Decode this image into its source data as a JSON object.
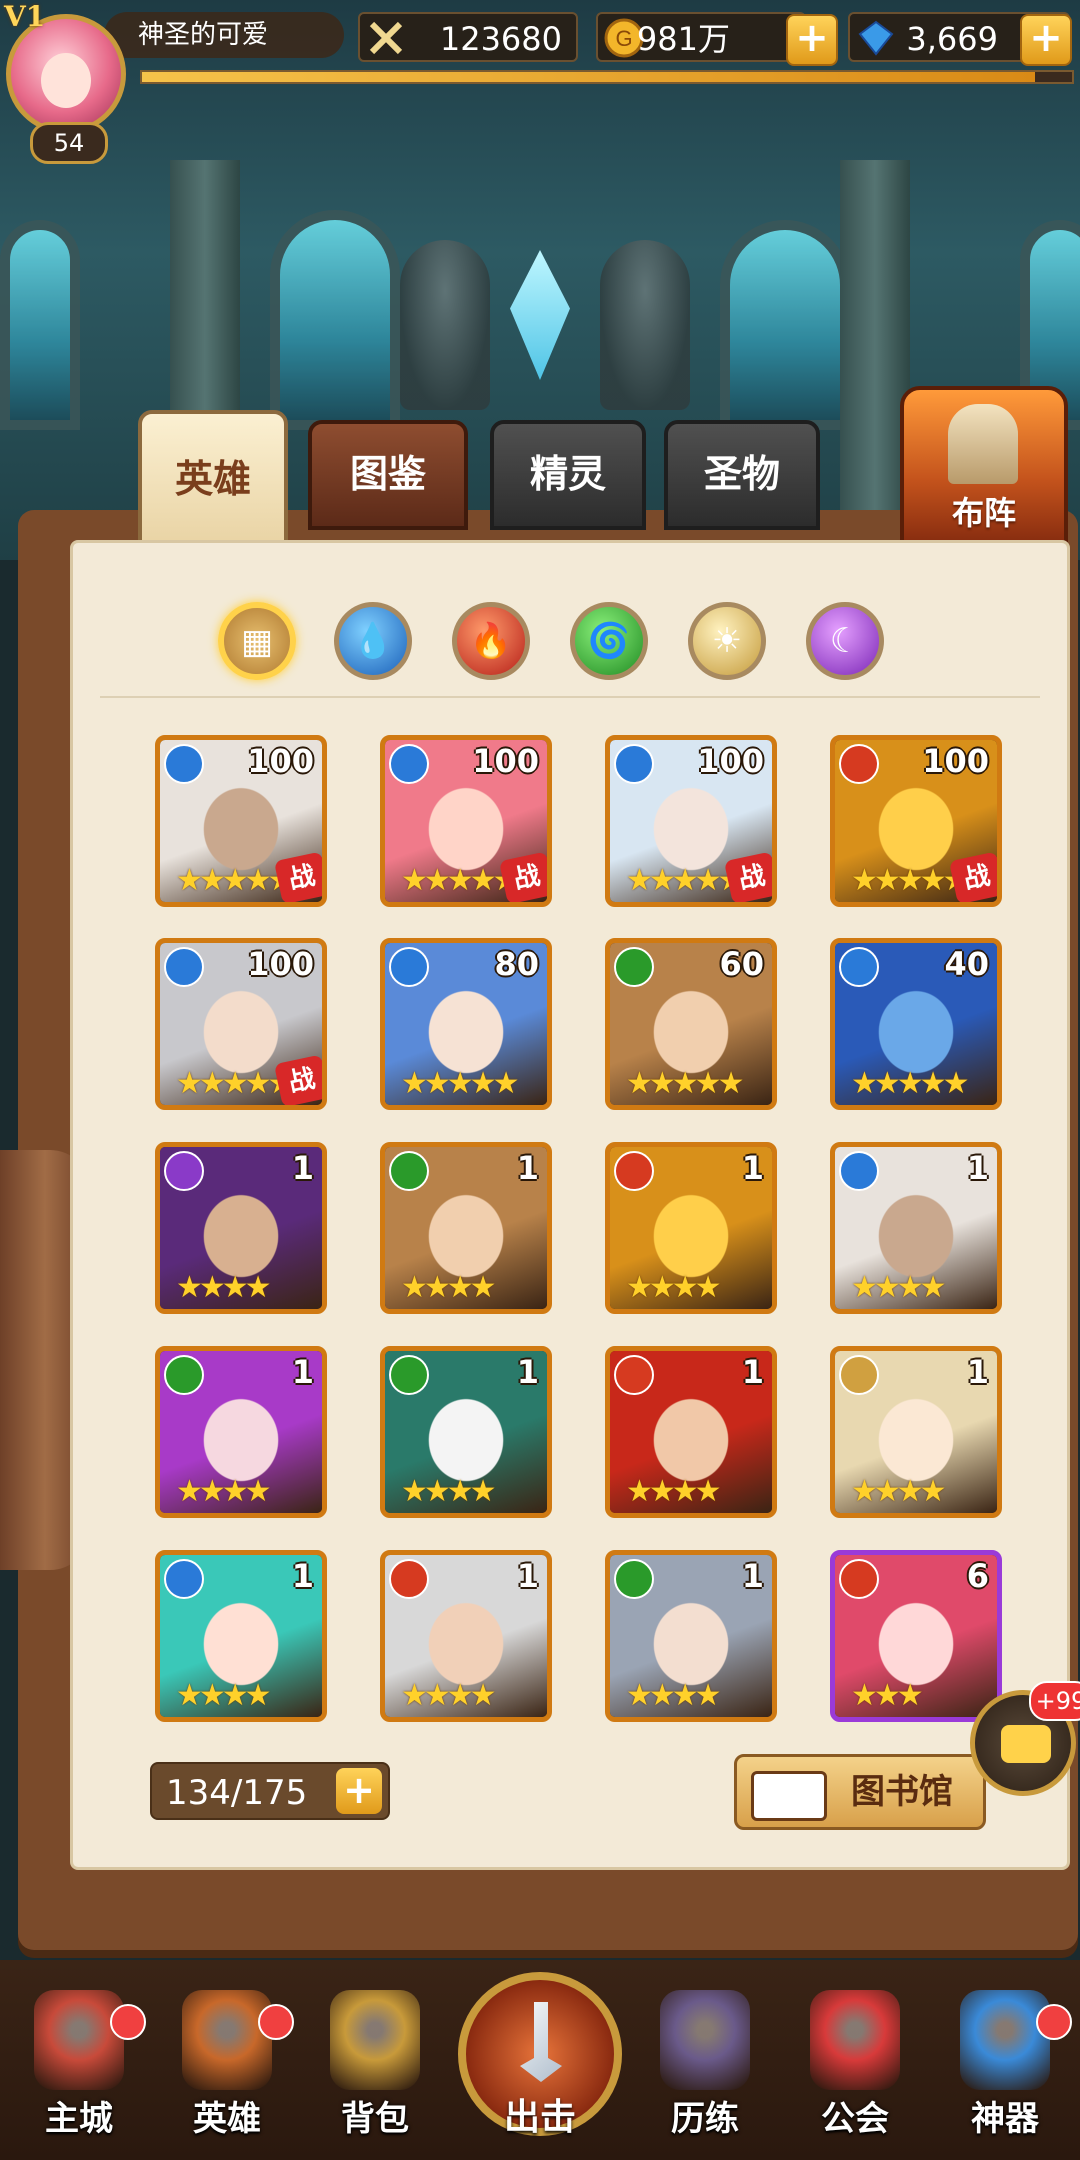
{
  "topbar": {
    "vip": "V1",
    "level": "54",
    "player_name": "神圣的可爱",
    "power": "123680",
    "gold": "981万",
    "gems": "3,669",
    "plus": "+"
  },
  "tabs": {
    "heroes": "英雄",
    "codex": "图鉴",
    "sprites": "精灵",
    "relics": "圣物",
    "formation": "布阵"
  },
  "filters": [
    {
      "name": "all",
      "icon": "grid-icon",
      "glyph": "▦"
    },
    {
      "name": "water",
      "icon": "water-drop-icon",
      "glyph": "💧"
    },
    {
      "name": "fire",
      "icon": "flame-icon",
      "glyph": "🔥"
    },
    {
      "name": "wind",
      "icon": "tornado-icon",
      "glyph": "🌀"
    },
    {
      "name": "light",
      "icon": "sun-icon",
      "glyph": "☀"
    },
    {
      "name": "dark",
      "icon": "moon-icon",
      "glyph": "☾"
    }
  ],
  "colors": {
    "water": "#2a7ad8",
    "fire": "#d63a20",
    "wind": "#2a9a2a",
    "light": "#d0a040",
    "dark": "#8a3ac8"
  },
  "heroes": [
    {
      "level": "100",
      "element": "water",
      "stars": "★★★★★",
      "battle": "战",
      "frame": "orange",
      "skin": "#c9a88e",
      "hair": "#e8e2dc"
    },
    {
      "level": "100",
      "element": "water",
      "stars": "★★★★★",
      "battle": "战",
      "frame": "orange",
      "skin": "#ffd4c8",
      "hair": "#f07a8a"
    },
    {
      "level": "100",
      "element": "water",
      "stars": "★★★★★",
      "battle": "战",
      "frame": "orange",
      "skin": "#f3e4dc",
      "hair": "#d8e6f2"
    },
    {
      "level": "100",
      "element": "fire",
      "stars": "★★★★★",
      "battle": "战",
      "frame": "orange",
      "skin": "#ffcf4a",
      "hair": "#d8901a"
    },
    {
      "level": "100",
      "element": "water",
      "stars": "★★★★★",
      "battle": "战",
      "frame": "orange",
      "skin": "#f3dccb",
      "hair": "#c8c8cc"
    },
    {
      "level": "80",
      "element": "water",
      "stars": "★★★★★",
      "battle": "",
      "frame": "orange",
      "skin": "#f6e2d4",
      "hair": "#5a8ad8"
    },
    {
      "level": "60",
      "element": "wind",
      "stars": "★★★★★",
      "battle": "",
      "frame": "orange",
      "skin": "#f1cfae",
      "hair": "#b8824a"
    },
    {
      "level": "40",
      "element": "water",
      "stars": "★★★★★",
      "battle": "",
      "frame": "orange",
      "skin": "#6aa8e8",
      "hair": "#2a5ab8"
    },
    {
      "level": "1",
      "element": "dark",
      "stars": "★★★★",
      "battle": "",
      "frame": "orange",
      "skin": "#d8b090",
      "hair": "#5a2a7a"
    },
    {
      "level": "1",
      "element": "wind",
      "stars": "★★★★",
      "battle": "",
      "frame": "orange",
      "skin": "#f1cfae",
      "hair": "#b8824a"
    },
    {
      "level": "1",
      "element": "fire",
      "stars": "★★★★",
      "battle": "",
      "frame": "orange",
      "skin": "#ffcf4a",
      "hair": "#d8901a"
    },
    {
      "level": "1",
      "element": "water",
      "stars": "★★★★",
      "battle": "",
      "frame": "orange",
      "skin": "#c9a88e",
      "hair": "#e8e2dc"
    },
    {
      "level": "1",
      "element": "wind",
      "stars": "★★★★",
      "battle": "",
      "frame": "orange",
      "skin": "#f6d8e0",
      "hair": "#a83ac8"
    },
    {
      "level": "1",
      "element": "wind",
      "stars": "★★★★",
      "battle": "",
      "frame": "orange",
      "skin": "#f4f4f4",
      "hair": "#2a7a6a"
    },
    {
      "level": "1",
      "element": "fire",
      "stars": "★★★★",
      "battle": "",
      "frame": "orange",
      "skin": "#f1c8a8",
      "hair": "#c8281a"
    },
    {
      "level": "1",
      "element": "light",
      "stars": "★★★★",
      "battle": "",
      "frame": "orange",
      "skin": "#fbe8d4",
      "hair": "#e8d8b0"
    },
    {
      "level": "1",
      "element": "water",
      "stars": "★★★★",
      "battle": "",
      "frame": "orange",
      "skin": "#ffe0d4",
      "hair": "#3ac8b8"
    },
    {
      "level": "1",
      "element": "fire",
      "stars": "★★★★",
      "battle": "",
      "frame": "orange",
      "skin": "#f1d0b8",
      "hair": "#d8d8d8"
    },
    {
      "level": "1",
      "element": "wind",
      "stars": "★★★★",
      "battle": "",
      "frame": "orange",
      "skin": "#f3ded0",
      "hair": "#9aa4b4"
    },
    {
      "level": "6",
      "element": "fire",
      "stars": "★★★",
      "battle": "",
      "frame": "purple",
      "skin": "#ffd8d8",
      "hair": "#e04a6a"
    }
  ],
  "roster": {
    "count": "134/175",
    "plus": "+"
  },
  "library": {
    "label": "图书馆"
  },
  "chat": {
    "badge": "+99"
  },
  "nav": [
    {
      "label": "主城",
      "icon": "castle-icon",
      "color": "#c84a3a",
      "dot": true
    },
    {
      "label": "英雄",
      "icon": "hero-icon",
      "color": "#c8682a",
      "dot": true
    },
    {
      "label": "背包",
      "icon": "bag-icon",
      "color": "#c89a3a",
      "dot": false
    },
    {
      "label": "出击",
      "icon": "crossed-swords-icon",
      "color": "#d8a43a",
      "dot": false
    },
    {
      "label": "历练",
      "icon": "demon-gate-icon",
      "color": "#6a5a8a",
      "dot": false
    },
    {
      "label": "公会",
      "icon": "guild-shield-icon",
      "color": "#d83a3a",
      "dot": false
    },
    {
      "label": "神器",
      "icon": "crystal-artifact-icon",
      "color": "#3a8ad8",
      "dot": true
    }
  ]
}
